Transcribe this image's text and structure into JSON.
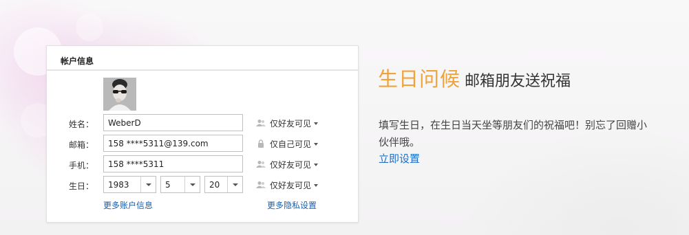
{
  "card": {
    "title": "帐户信息",
    "fields": {
      "name": {
        "label": "姓名：",
        "value": "WeberD",
        "privacy": "仅好友可见"
      },
      "email": {
        "label": "邮箱：",
        "value": "158 ****5311@139.com",
        "privacy": "仅自己可见"
      },
      "phone": {
        "label": "手机：",
        "value": "158 ****5311",
        "privacy": "仅好友可见"
      },
      "birthday": {
        "label": "生日：",
        "year": "1983",
        "month": "5",
        "day": "20",
        "privacy": "仅好友可见"
      }
    },
    "more_account_link": "更多账户信息",
    "more_privacy_link": "更多隐私设置"
  },
  "promo": {
    "title_highlight": "生日问候",
    "title_rest": "邮箱朋友送祝福",
    "description": "填写生日，在生日当天坐等朋友们的祝福吧！别忘了回赠小伙伴哦。",
    "action_link": "立即设置"
  },
  "colors": {
    "accent_orange": "#f0a23b",
    "link_blue": "#1a6fc9"
  },
  "icons": {
    "friends_privacy": "friends-icon",
    "self_privacy": "lock-icon",
    "dropdown": "chevron-down-icon"
  }
}
